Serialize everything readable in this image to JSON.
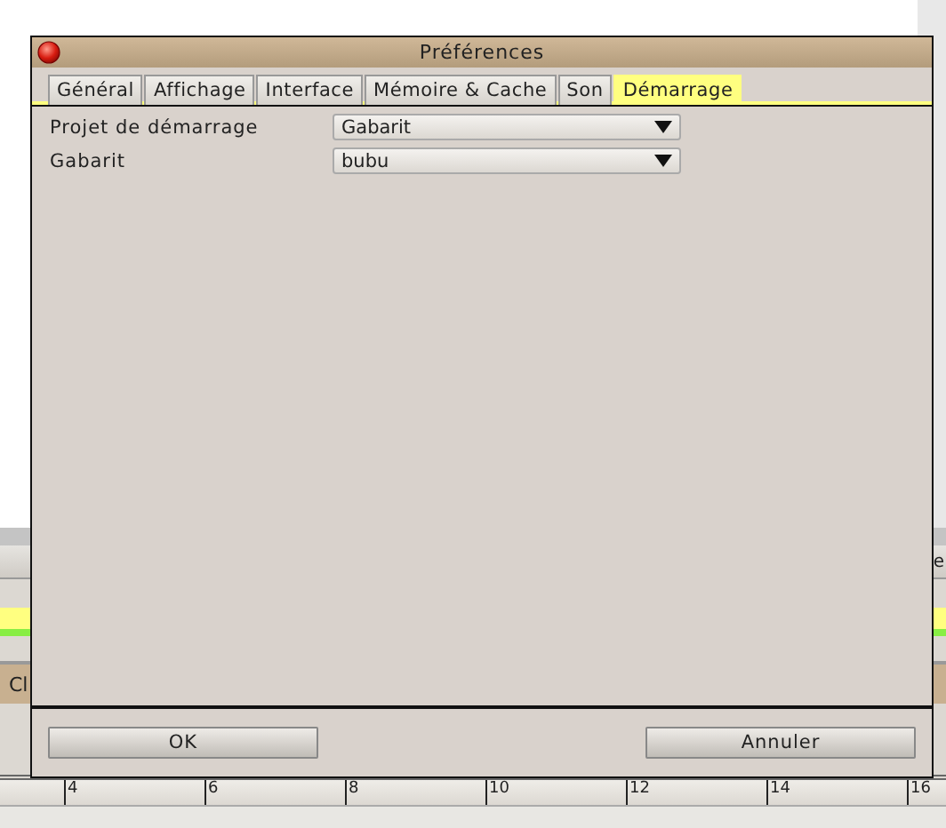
{
  "window": {
    "title": "Préférences"
  },
  "tabs": [
    {
      "label": "Général",
      "selected": false
    },
    {
      "label": "Affichage",
      "selected": false
    },
    {
      "label": "Interface",
      "selected": false
    },
    {
      "label": "Mémoire & Cache",
      "selected": false
    },
    {
      "label": "Son",
      "selected": false
    },
    {
      "label": "Démarrage",
      "selected": true
    }
  ],
  "fields": [
    {
      "label": "Projet de démarrage",
      "value": "Gabarit"
    },
    {
      "label": "Gabarit",
      "value": "bubu"
    }
  ],
  "buttons": [
    "OK",
    "Annuler"
  ],
  "background": {
    "toolbar_text": "e",
    "bar_text": "Cl",
    "ruler": [
      "4",
      "6",
      "8",
      "10",
      "12",
      "14",
      "16"
    ]
  }
}
